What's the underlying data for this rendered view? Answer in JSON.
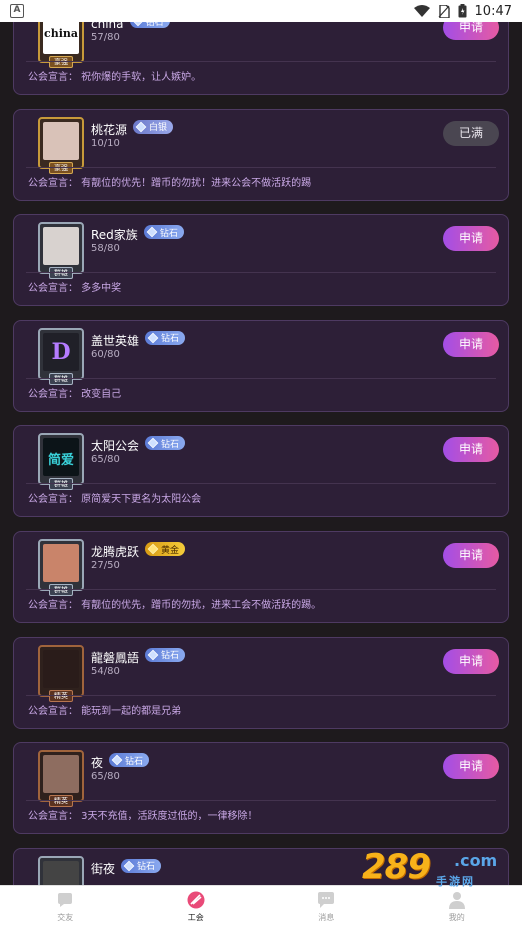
{
  "status_bar": {
    "time": "10:47",
    "app_icon_letter": "A"
  },
  "guilds": [
    {
      "name": "china",
      "level": "钻石",
      "level_color": "blue",
      "members": "57/80",
      "declaration": "公会宣言：  祝你爆的手软，让人嫉妒。",
      "action": "申请",
      "frame": "gold",
      "frame_tag": "豪强",
      "avatar_text": "china",
      "avatar_color": "#ffffff"
    },
    {
      "name": "桃花源",
      "level": "白银",
      "level_color": "silver",
      "members": "10/10",
      "declaration": "公会宣言：  有靓位的优先！蹭币的勿扰！进来公会不做活跃的踢",
      "action": "已满",
      "frame": "gold",
      "frame_tag": "豪强",
      "avatar_text": "",
      "avatar_color": "#d9c2b8"
    },
    {
      "name": "Red家族",
      "level": "钻石",
      "level_color": "blue",
      "members": "58/80",
      "declaration": "公会宣言：  多多中奖",
      "action": "申请",
      "frame": "silver",
      "frame_tag": "群雄",
      "avatar_text": "",
      "avatar_color": "#d8d2cf"
    },
    {
      "name": "盖世英雄",
      "level": "钻石",
      "level_color": "blue",
      "members": "60/80",
      "declaration": "公会宣言：  改变自己",
      "action": "申请",
      "frame": "silver",
      "frame_tag": "群雄",
      "avatar_text": "D",
      "avatar_color": "#202028"
    },
    {
      "name": "太阳公会",
      "level": "钻石",
      "level_color": "blue",
      "members": "65/80",
      "declaration": "公会宣言：  原简爱天下更名为太阳公会",
      "action": "申请",
      "frame": "silver",
      "frame_tag": "群雄",
      "avatar_text": "简爱",
      "avatar_color": "#0c1418"
    },
    {
      "name": "龙腾虎跃",
      "level": "黄金",
      "level_color": "gold",
      "members": "27/50",
      "declaration": "公会宣言：  有靓位的优先，蹭币的勿扰，进来工会不做活跃的踢。",
      "action": "申请",
      "frame": "silver",
      "frame_tag": "群雄",
      "avatar_text": "",
      "avatar_color": "#c9846a"
    },
    {
      "name": "龍磐鳳語",
      "level": "钻石",
      "level_color": "blue",
      "members": "54/80",
      "declaration": "公会宣言：  能玩到一起的都是兄弟",
      "action": "申请",
      "frame": "bronze",
      "frame_tag": "精英",
      "avatar_text": "",
      "avatar_color": "#2a1c1a"
    },
    {
      "name": "夜",
      "level": "钻石",
      "level_color": "blue",
      "members": "65/80",
      "declaration": "公会宣言：  3天不充值，活跃度过低的，一律移除！",
      "action": "申请",
      "frame": "bronze",
      "frame_tag": "精英",
      "avatar_text": "",
      "avatar_color": "#8e6d60"
    },
    {
      "name": "街夜",
      "level": "钻石",
      "level_color": "blue",
      "members": "",
      "declaration": "",
      "action": "",
      "frame": "silver",
      "frame_tag": "",
      "avatar_text": "",
      "avatar_color": "#444"
    }
  ],
  "tabs": [
    {
      "label": "交友",
      "icon": "friends-icon",
      "active": false
    },
    {
      "label": "工会",
      "icon": "guild-icon",
      "active": true
    },
    {
      "label": "消息",
      "icon": "message-icon",
      "active": false
    },
    {
      "label": "我的",
      "icon": "profile-icon",
      "active": false
    }
  ],
  "watermark": {
    "number": "289",
    "domain": ".com",
    "sub": "手游网"
  }
}
